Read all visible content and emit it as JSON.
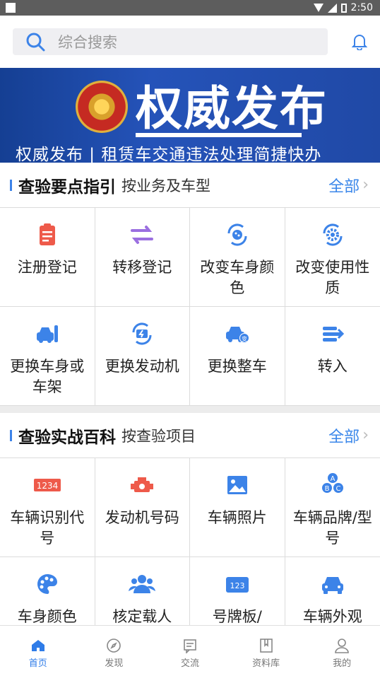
{
  "status_bar": {
    "time": "2:50"
  },
  "search": {
    "placeholder": "综合搜索"
  },
  "banner": {
    "title": "权威发布",
    "subtitle": "权威发布 | 租赁车交通违法处理简捷快办"
  },
  "section1": {
    "title": "查验要点指引",
    "subtitle": "按业务及车型",
    "all_label": "全部",
    "items": [
      {
        "label": "注册登记",
        "icon": "clipboard-icon",
        "color": "#ee5a4a"
      },
      {
        "label": "转移登记",
        "icon": "transfer-arrows-icon",
        "color": "#9b6fe0"
      },
      {
        "label": "改变车身颜色",
        "icon": "car-color-change-icon",
        "color": "#3c83e8"
      },
      {
        "label": "改变使用性质",
        "icon": "gear-change-icon",
        "color": "#3c83e8"
      },
      {
        "label": "更换车身或车架",
        "icon": "car-repair-icon",
        "color": "#3c83e8"
      },
      {
        "label": "更换发动机",
        "icon": "engine-change-icon",
        "color": "#3c83e8"
      },
      {
        "label": "更换整车",
        "icon": "car-swap-icon",
        "color": "#3c83e8"
      },
      {
        "label": "转入",
        "icon": "transfer-in-icon",
        "color": "#3c83e8"
      }
    ]
  },
  "section2": {
    "title": "查验实战百科",
    "subtitle": "按查验项目",
    "all_label": "全部",
    "items": [
      {
        "label": "车辆识别代号",
        "icon": "vin-1234-icon",
        "color": "#ee5a4a",
        "text": "1234"
      },
      {
        "label": "发动机号码",
        "icon": "engine-icon",
        "color": "#ee5a4a"
      },
      {
        "label": "车辆照片",
        "icon": "photo-icon",
        "color": "#3c83e8"
      },
      {
        "label": "车辆品牌/型号",
        "icon": "abc-icon",
        "color": "#3c83e8"
      },
      {
        "label": "车身颜色",
        "icon": "palette-icon",
        "color": "#3c83e8"
      },
      {
        "label": "核定载人",
        "icon": "people-icon",
        "color": "#3c83e8"
      },
      {
        "label": "号牌板/",
        "icon": "plate-123-icon",
        "color": "#3c83e8",
        "text": "123"
      },
      {
        "label": "车辆外观",
        "icon": "car-front-icon",
        "color": "#3c83e8"
      }
    ]
  },
  "tabs": [
    {
      "label": "首页",
      "icon": "home-icon",
      "active": true
    },
    {
      "label": "发现",
      "icon": "compass-icon",
      "active": false
    },
    {
      "label": "交流",
      "icon": "chat-icon",
      "active": false
    },
    {
      "label": "资料库",
      "icon": "book-icon",
      "active": false
    },
    {
      "label": "我的",
      "icon": "user-icon",
      "active": false
    }
  ]
}
